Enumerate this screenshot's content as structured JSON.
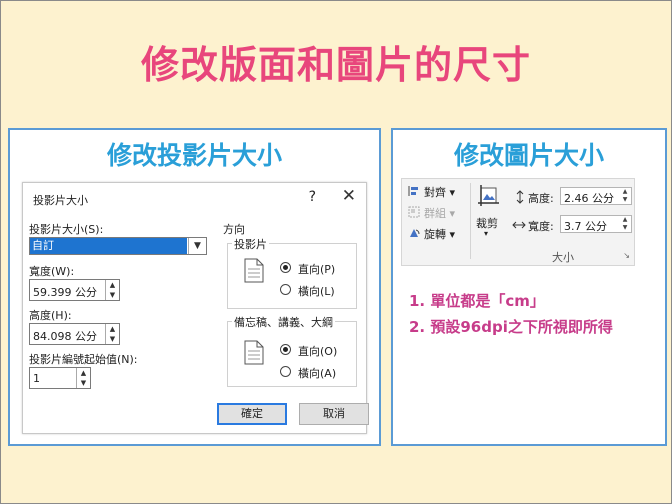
{
  "slide": {
    "title": "修改版面和圖片的尺寸",
    "left_heading": "修改投影片大小",
    "right_heading": "修改圖片大小",
    "colors": {
      "background": "#fdf2cf",
      "title": "#e8467c",
      "heading": "#2a9fd8",
      "panel_border": "#5b9bd5",
      "notes": "#c73c8a"
    }
  },
  "dialog": {
    "title": "投影片大小",
    "help": "?",
    "close": "✕",
    "size_label": "投影片大小(S):",
    "size_value": "自訂",
    "width_label": "寬度(W):",
    "width_value": "59.399 公分",
    "height_label": "高度(H):",
    "height_value": "84.098 公分",
    "numbering_label": "投影片編號起始值(N):",
    "numbering_value": "1",
    "orientation_label": "方向",
    "slides_group": "投影片",
    "notes_group": "備忘稿、講義、大綱",
    "portrait": "直向(P)",
    "landscape": "橫向(L)",
    "portrait2": "直向(O)",
    "landscape2": "橫向(A)",
    "ok": "確定",
    "cancel": "取消"
  },
  "ribbon": {
    "align": "對齊",
    "group": "群組",
    "rotate": "旋轉",
    "crop": "裁剪",
    "height_label": "高度:",
    "height_value": "2.46 公分",
    "width_label": "寬度:",
    "width_value": "3.7 公分",
    "size_group": "大小"
  },
  "notes": [
    "1. 單位都是「cm」",
    "2. 預設96dpi之下所視即所得"
  ]
}
